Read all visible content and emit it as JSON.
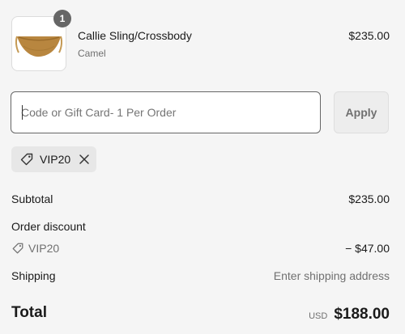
{
  "line_item": {
    "quantity": "1",
    "title": "Callie Sling/Crossbody",
    "variant": "Camel",
    "price": "$235.00",
    "image_icon": "bag-thumbnail"
  },
  "discount": {
    "placeholder": "Code or Gift Card- 1 Per Order",
    "value": "",
    "apply_label": "Apply",
    "applied_code": "VIP20"
  },
  "summary": {
    "subtotal_label": "Subtotal",
    "subtotal_value": "$235.00",
    "order_discount_label": "Order discount",
    "discount_code": "VIP20",
    "discount_value": "− $47.00",
    "shipping_label": "Shipping",
    "shipping_value": "Enter shipping address",
    "total_label": "Total",
    "total_currency": "USD",
    "total_value": "$188.00"
  },
  "colors": {
    "background": "#f5f5f5",
    "text": "#1a1a1a",
    "muted": "#707070",
    "badge": "#666666"
  }
}
